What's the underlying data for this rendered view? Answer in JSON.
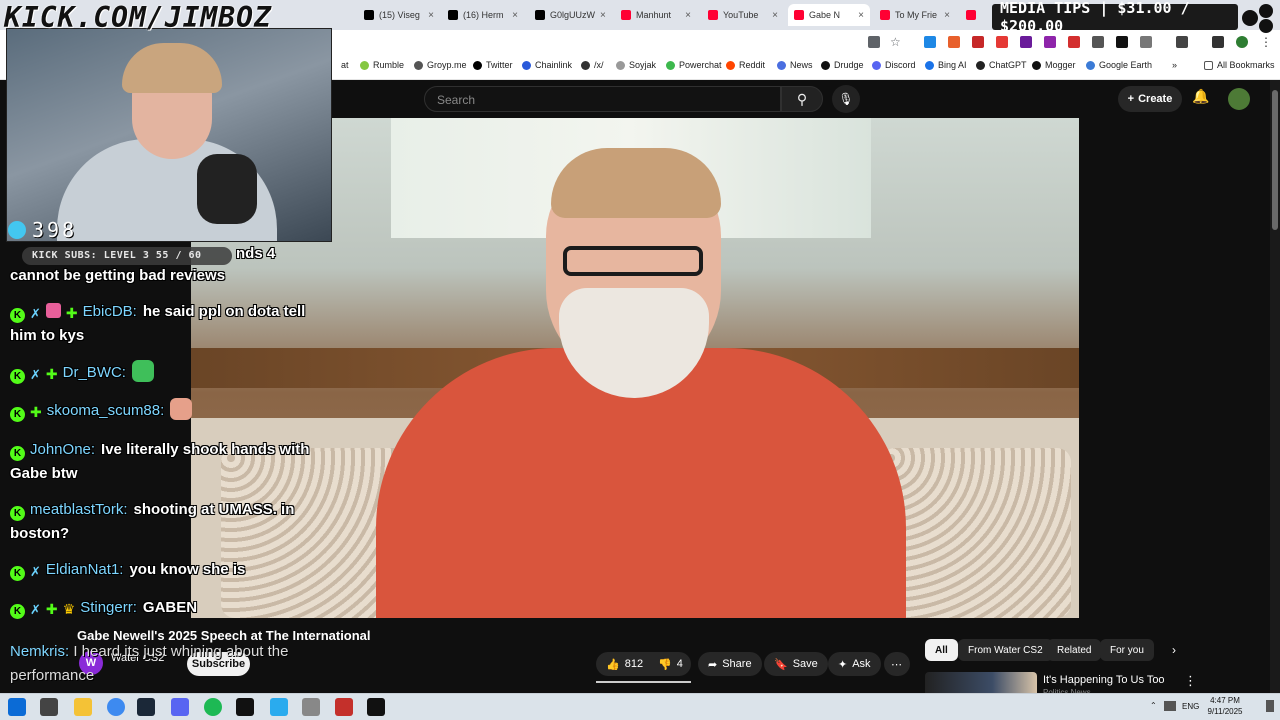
{
  "overlay": {
    "site_banner": "KICK.COM/JIMBOZ",
    "media_tips": "MEDIA TIPS | $31.00 / $200.00",
    "viewer_count": "398",
    "kick_subs": "KICK SUBS: LEVEL 3 55 / 60"
  },
  "tabs": [
    {
      "label": "(15) Viseg",
      "color": "#000000"
    },
    {
      "label": "(16) Herm",
      "color": "#000000"
    },
    {
      "label": "G0lgUUzW",
      "color": "#000000"
    },
    {
      "label": "Manhunt",
      "color": "#ff0033"
    },
    {
      "label": "YouTube",
      "color": "#ff0033"
    },
    {
      "label": "Gabe N",
      "color": "#ff0033"
    },
    {
      "label": "To My Frie",
      "color": "#ff0033"
    },
    {
      "label": "",
      "color": "#ff0033"
    }
  ],
  "bookmarks": [
    {
      "label": "at",
      "icon": "cut-off-icon",
      "color": "#888888"
    },
    {
      "label": "Rumble",
      "icon": "rumble-icon",
      "color": "#85c742"
    },
    {
      "label": "Groyp.me",
      "icon": "frog-icon",
      "color": "#555555"
    },
    {
      "label": "Twitter",
      "icon": "x-icon",
      "color": "#000000"
    },
    {
      "label": "Chainlink",
      "icon": "chainlink-icon",
      "color": "#2a5ada"
    },
    {
      "label": "/x/",
      "icon": "clover-icon",
      "color": "#333333"
    },
    {
      "label": "Soyjak",
      "icon": "soyjak-icon",
      "color": "#999999"
    },
    {
      "label": "Powerchat",
      "icon": "powerchat-icon",
      "color": "#3db84d"
    },
    {
      "label": "Reddit",
      "icon": "reddit-icon",
      "color": "#ff4500"
    },
    {
      "label": "News",
      "icon": "news-icon",
      "color": "#4a6ee0"
    },
    {
      "label": "Drudge",
      "icon": "drudge-icon",
      "color": "#111111"
    },
    {
      "label": "Discord",
      "icon": "discord-icon",
      "color": "#5865f2"
    },
    {
      "label": "Bing AI",
      "icon": "bing-icon",
      "color": "#1a73e8"
    },
    {
      "label": "ChatGPT",
      "icon": "chatgpt-icon",
      "color": "#222222"
    },
    {
      "label": "Mogger",
      "icon": "mogger-icon",
      "color": "#111111"
    },
    {
      "label": "Google Earth",
      "icon": "earth-icon",
      "color": "#3b7bd6"
    }
  ],
  "all_bookmarks": "All Bookmarks",
  "yt": {
    "search_placeholder": "Search",
    "create": "Create",
    "video_title": "Gabe Newell's 2025 Speech at The International",
    "channel_avatar": "W",
    "channel_name": "Water CS2",
    "subscribe": "Subscribe",
    "likes": "812",
    "dislikes": "4",
    "share": "Share",
    "save": "Save",
    "ask": "Ask",
    "chips": [
      "All",
      "From Water CS2",
      "Related",
      "For you"
    ],
    "rec_title": "It's Happening To Us Too",
    "rec_channel": "Politics News"
  },
  "chat": [
    {
      "user": "",
      "text": "nds 4",
      "badges": []
    },
    {
      "user": "",
      "text": "cannot be getting bad reviews",
      "badges": []
    },
    {
      "user": "EbicDB:",
      "text": "he said ppl on dota tell him to kys",
      "badges": [
        "k",
        "sword",
        "gift",
        "diamond"
      ]
    },
    {
      "user": "Dr_BWC:",
      "text": "",
      "badges": [
        "k",
        "sword",
        "diamond"
      ]
    },
    {
      "user": "skooma_scum88:",
      "text": "",
      "badges": [
        "k",
        "diamond"
      ]
    },
    {
      "user": "JohnOne:",
      "text": "Ive literally shook hands with Gabe btw",
      "badges": [
        "k"
      ]
    },
    {
      "user": "meatblastTork:",
      "text": "shooting at UMASS. in boston?",
      "badges": [
        "k"
      ]
    },
    {
      "user": "EldianNat1:",
      "text": "you know she is",
      "badges": [
        "k",
        "sword"
      ]
    },
    {
      "user": "Stingerr:",
      "text": "GABEN",
      "badges": [
        "k",
        "sword",
        "diamond",
        "crown"
      ]
    }
  ],
  "bottom_chat": {
    "user": "Nemkris:",
    "text": "I heard its just whining about the performance"
  },
  "taskbar": {
    "lang": "ENG",
    "time": "4:47 PM",
    "date": "9/11/2025"
  }
}
